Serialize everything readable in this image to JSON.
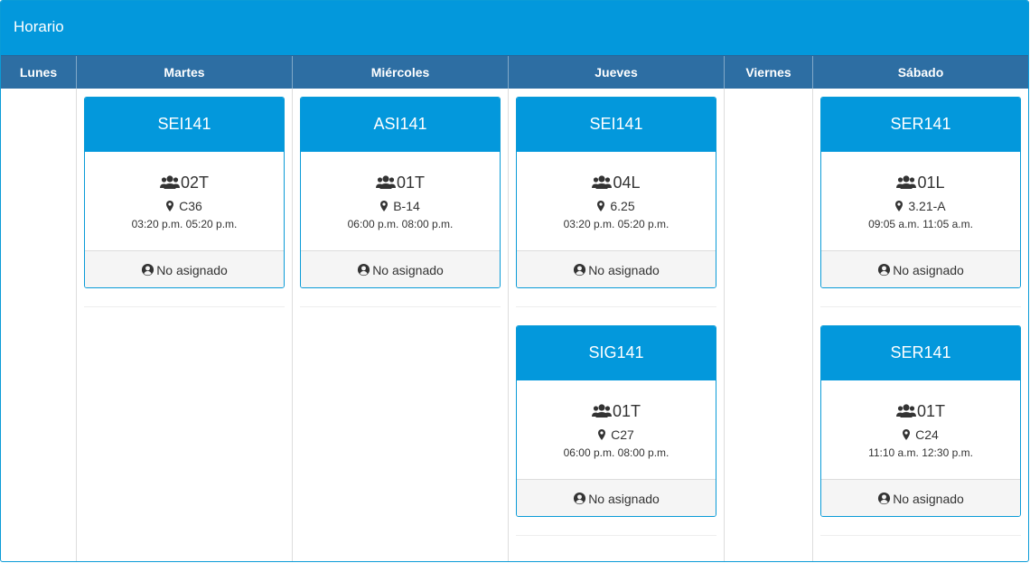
{
  "header": {
    "title": "Horario"
  },
  "days": [
    "Lunes",
    "Martes",
    "Miércoles",
    "Jueves",
    "Viernes",
    "Sábado"
  ],
  "schedule": {
    "martes": [
      {
        "course": "SEI141",
        "group": "02T",
        "room": "C36",
        "time": "03:20 p.m. 05:20 p.m.",
        "teacher": "No asignado"
      }
    ],
    "miercoles": [
      {
        "course": "ASI141",
        "group": "01T",
        "room": "B-14",
        "time": "06:00 p.m. 08:00 p.m.",
        "teacher": "No asignado"
      }
    ],
    "jueves": [
      {
        "course": "SEI141",
        "group": "04L",
        "room": "6.25",
        "time": "03:20 p.m. 05:20 p.m.",
        "teacher": "No asignado"
      },
      {
        "course": "SIG141",
        "group": "01T",
        "room": "C27",
        "time": "06:00 p.m. 08:00 p.m.",
        "teacher": "No asignado"
      }
    ],
    "sabado": [
      {
        "course": "SER141",
        "group": "01L",
        "room": "3.21-A",
        "time": "09:05 a.m. 11:05 a.m.",
        "teacher": "No asignado"
      },
      {
        "course": "SER141",
        "group": "01T",
        "room": "C24",
        "time": "11:10 a.m. 12:30 p.m.",
        "teacher": "No asignado"
      }
    ]
  },
  "colors": {
    "primary": "#0398dc",
    "header_bar": "#2d6ea3",
    "footer_bg": "#f5f5f5"
  },
  "icons": {
    "group": "users-icon",
    "room": "map-marker-icon",
    "teacher": "user-circle-icon"
  }
}
